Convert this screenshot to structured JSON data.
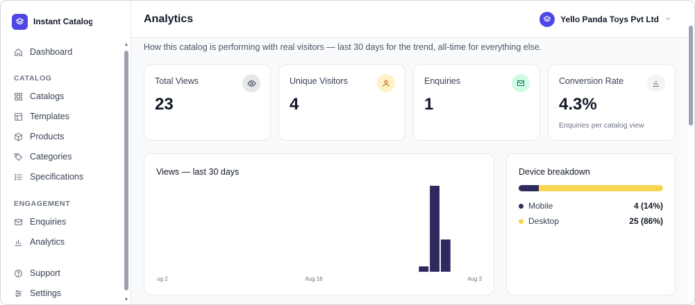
{
  "brand": {
    "name": "Instant Catalog",
    "icon": "layers-icon",
    "color": "#4f46e5"
  },
  "sidebar": {
    "top": [
      {
        "label": "Dashboard",
        "icon": "home-icon"
      }
    ],
    "sections": [
      {
        "title": "CATALOG",
        "items": [
          {
            "label": "Catalogs",
            "icon": "grid-icon"
          },
          {
            "label": "Templates",
            "icon": "layout-icon"
          },
          {
            "label": "Products",
            "icon": "box-icon"
          },
          {
            "label": "Categories",
            "icon": "tag-icon"
          },
          {
            "label": "Specifications",
            "icon": "list-icon"
          }
        ]
      },
      {
        "title": "ENGAGEMENT",
        "items": [
          {
            "label": "Enquiries",
            "icon": "mail-icon"
          },
          {
            "label": "Analytics",
            "icon": "bar-chart-icon"
          }
        ]
      }
    ],
    "bottom": [
      {
        "label": "Support",
        "icon": "help-icon"
      },
      {
        "label": "Settings",
        "icon": "sliders-icon"
      }
    ]
  },
  "header": {
    "title": "Analytics",
    "org_name": "Yello Panda Toys Pvt Ltd"
  },
  "subtitle": "How this catalog is performing with real visitors — last 30 days for the trend, all-time for everything else.",
  "stats": [
    {
      "label": "Total Views",
      "value": "23",
      "hint": "",
      "icon": "eye-icon",
      "icon_bg": "#e5e7eb"
    },
    {
      "label": "Unique Visitors",
      "value": "4",
      "hint": "",
      "icon": "user-icon",
      "icon_bg": "#fef3c7"
    },
    {
      "label": "Enquiries",
      "value": "1",
      "hint": "",
      "icon": "mail-icon",
      "icon_bg": "#d1fae5"
    },
    {
      "label": "Conversion Rate",
      "value": "4.3%",
      "hint": "Enquiries per catalog view",
      "icon": "bar-chart-icon",
      "icon_bg": "#f3f4f6"
    }
  ],
  "chart_data": {
    "type": "bar",
    "title": "Views — last 30 days",
    "x_tick_labels": [
      "ug 2",
      "Aug 16",
      "Aug 3"
    ],
    "values": [
      0,
      0,
      0,
      0,
      0,
      0,
      0,
      0,
      0,
      0,
      0,
      0,
      0,
      0,
      0,
      0,
      0,
      0,
      0,
      0,
      0,
      0,
      0,
      0,
      1,
      16,
      6,
      0,
      0,
      0
    ],
    "ylim": [
      0,
      16
    ],
    "color": "#2f2a5e",
    "grid": false
  },
  "devices": {
    "title": "Device breakdown",
    "items": [
      {
        "name": "Mobile",
        "value": "4 (14%)",
        "share": 0.14,
        "color": "#2f2a5e"
      },
      {
        "name": "Desktop",
        "value": "25 (86%)",
        "share": 0.86,
        "color": "#f9d44e"
      }
    ]
  }
}
